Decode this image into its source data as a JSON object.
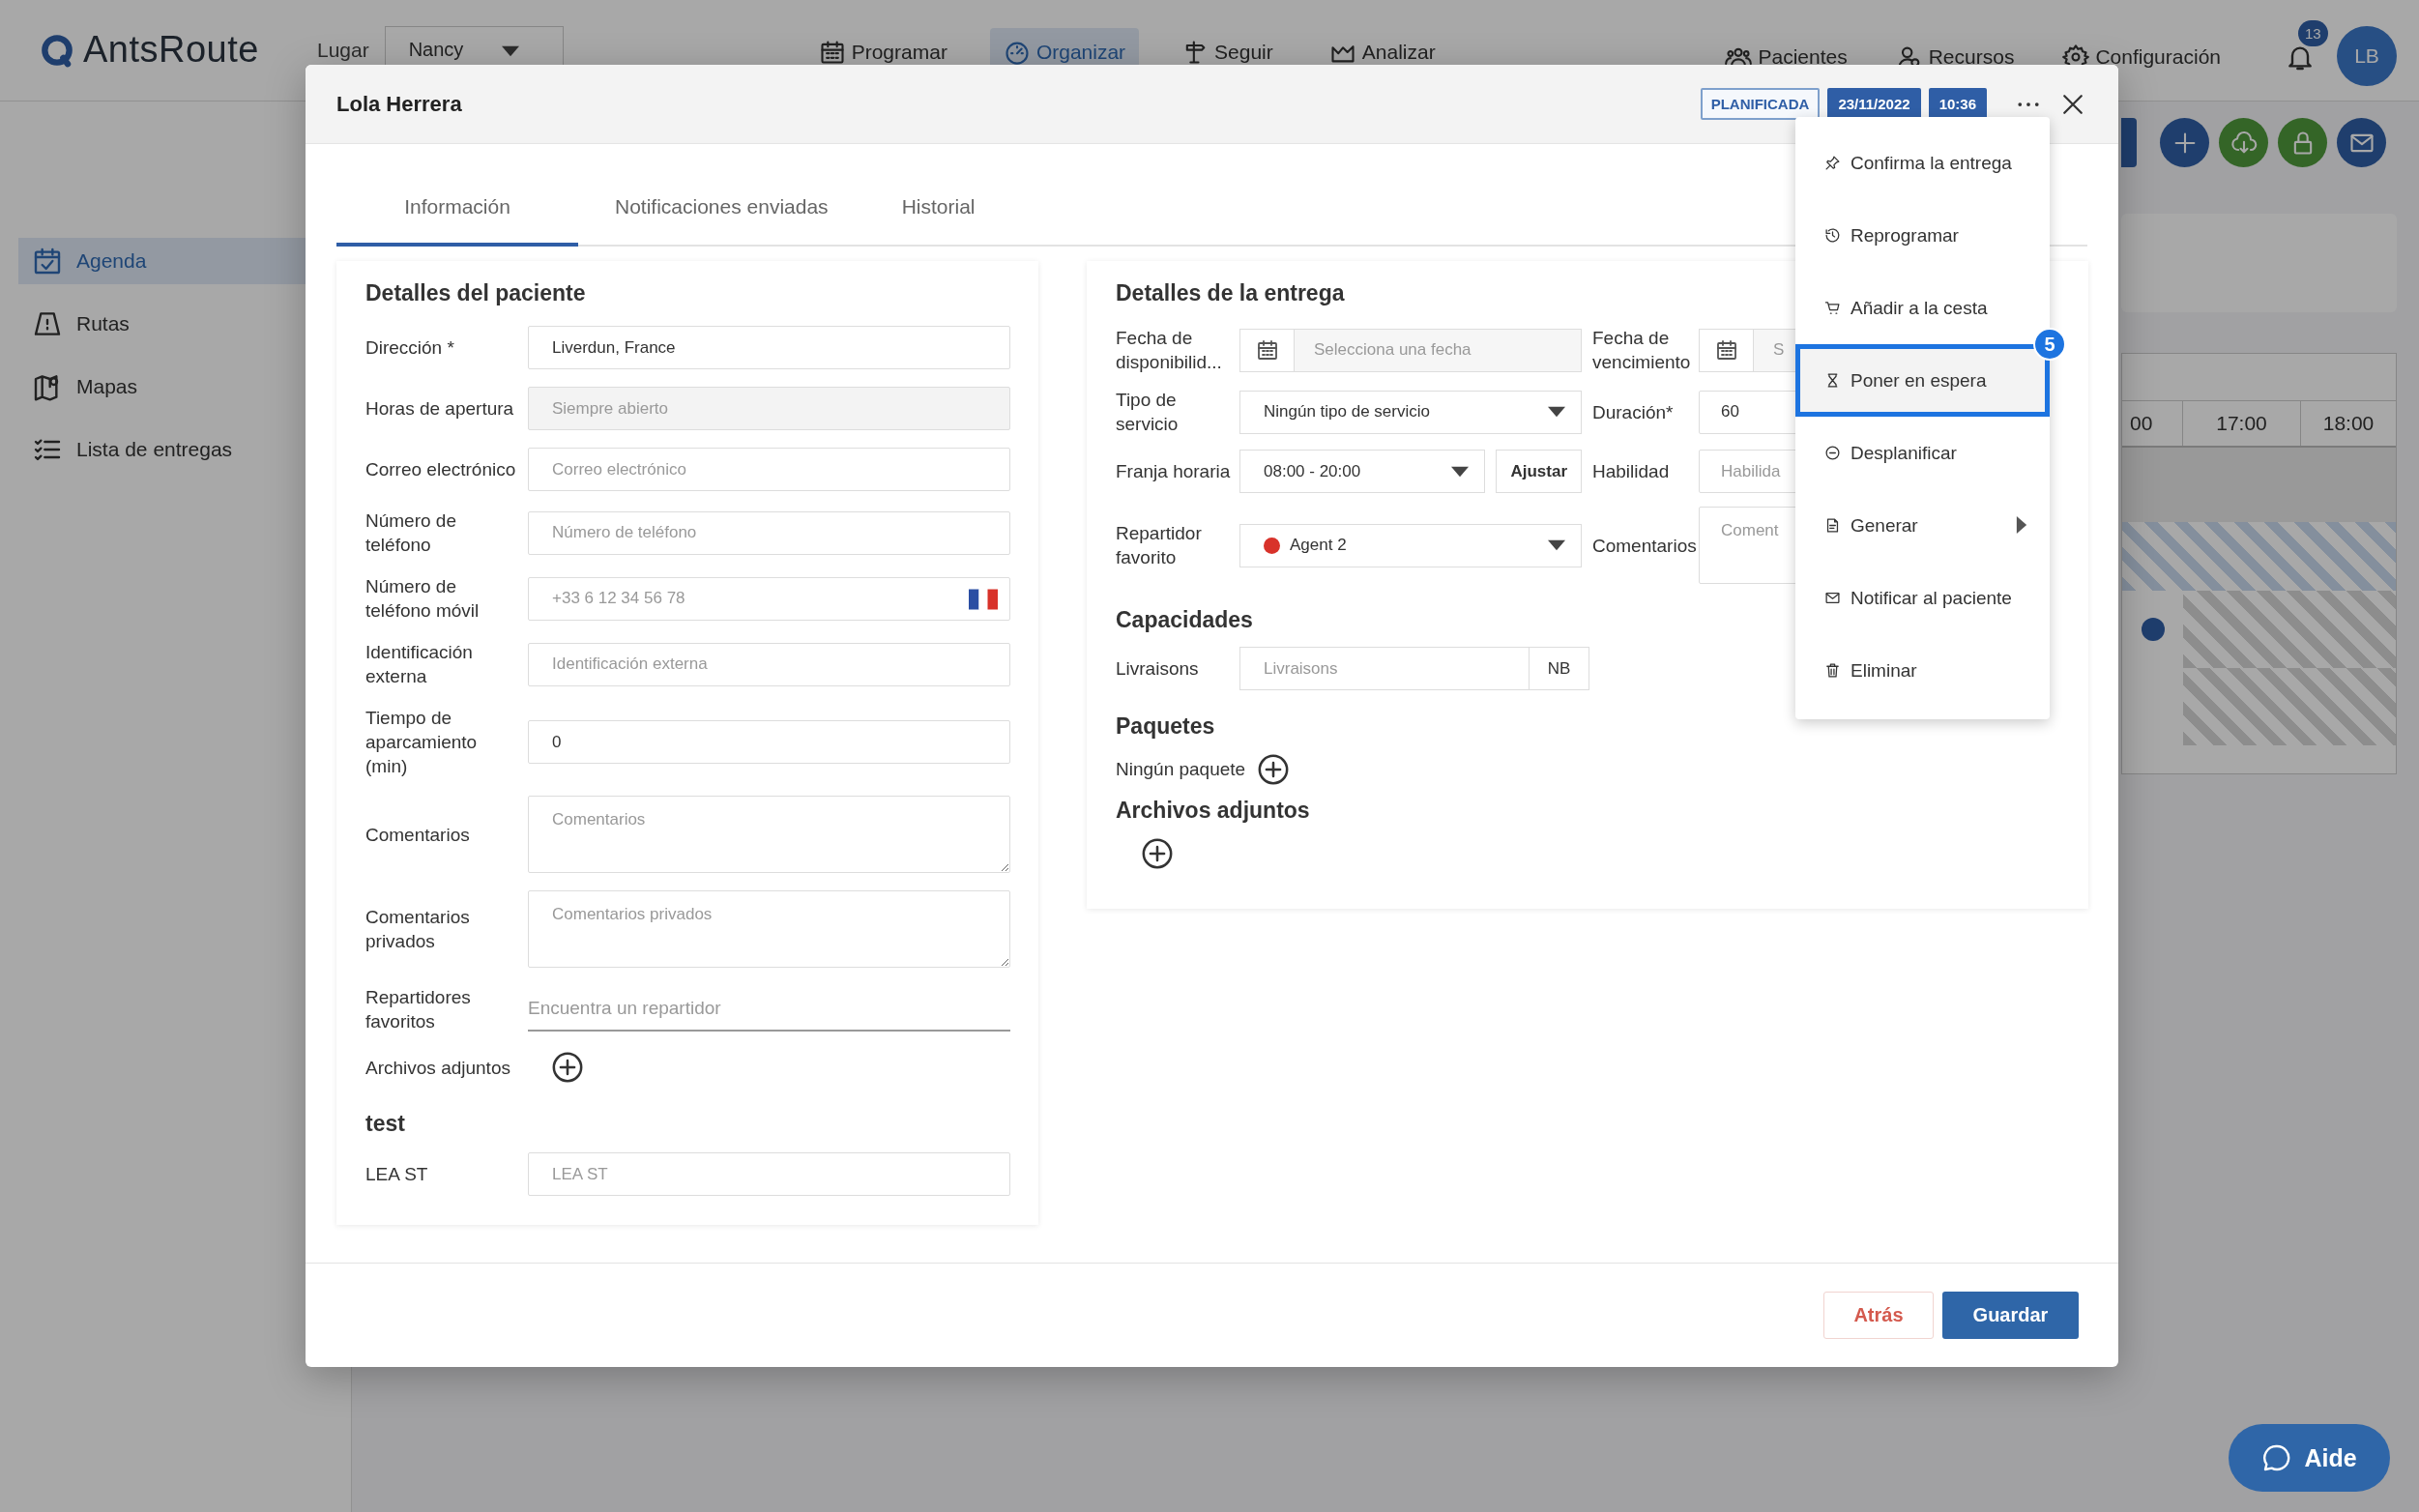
{
  "topbar": {
    "logo": "AntsRoute",
    "location_label": "Lugar",
    "location": "Nancy",
    "nav": [
      {
        "label": "Programar",
        "selected": false
      },
      {
        "label": "Organizar",
        "selected": true
      },
      {
        "label": "Seguir",
        "selected": false
      },
      {
        "label": "Analizar",
        "selected": false
      }
    ],
    "shortcuts": [
      "Pacientes",
      "Recursos",
      "Configuración"
    ],
    "notifications": "13",
    "avatar": "LB"
  },
  "sidebar": {
    "items": [
      {
        "label": "Agenda",
        "selected": true
      },
      {
        "label": "Rutas",
        "selected": false
      },
      {
        "label": "Mapas",
        "selected": false
      },
      {
        "label": "Lista de entregas",
        "selected": false
      }
    ]
  },
  "planner": {
    "timeline": {
      "columns": [
        "00",
        "17:00",
        "18:00"
      ]
    }
  },
  "modal": {
    "title": "Lola Herrera",
    "status": "PLANIFICADA",
    "date": "23/11/2022",
    "time": "10:36",
    "tabs": [
      {
        "label": "Información",
        "selected": true
      },
      {
        "label": "Notificaciones enviadas",
        "selected": false
      },
      {
        "label": "Historial",
        "selected": false
      }
    ],
    "patient": {
      "title": "Detalles del paciente",
      "fields": [
        {
          "label": "Dirección *",
          "kind": "input",
          "value": "Liverdun, France"
        },
        {
          "label": "Horas de apertura",
          "kind": "input",
          "placeholder": "Siempre abierto",
          "disabled": true
        },
        {
          "label": "Correo electrónico",
          "kind": "input",
          "placeholder": "Correo electrónico"
        },
        {
          "label": "Número de teléfono",
          "kind": "input",
          "placeholder": "Número de teléfono"
        },
        {
          "label": "Número de teléfono móvil",
          "kind": "phone",
          "placeholder": "+33 6 12 34 56 78"
        },
        {
          "label": "Identificación externa",
          "kind": "input",
          "placeholder": "Identificación externa"
        },
        {
          "label": "Tiempo de aparcamiento (min)",
          "kind": "input",
          "value": "0"
        },
        {
          "label": "Comentarios",
          "kind": "textarea",
          "placeholder": "Comentarios"
        },
        {
          "label": "Comentarios privados",
          "kind": "textarea",
          "placeholder": "Comentarios privados"
        },
        {
          "label": "Repartidores favoritos",
          "kind": "search",
          "placeholder": "Encuentra un repartidor"
        },
        {
          "label": "Archivos adjuntos",
          "kind": "attach"
        }
      ],
      "custom_title": "test",
      "custom_fields": [
        {
          "label": "LEA ST",
          "kind": "input",
          "placeholder": "LEA ST"
        }
      ]
    },
    "delivery": {
      "title": "Detalles de la entrega",
      "rows": [
        {
          "left": {
            "label": "Fecha de disponibilid...",
            "kind": "date",
            "placeholder": "Selecciona una fecha"
          },
          "right": {
            "label": "Fecha de vencimiento",
            "kind": "date",
            "placeholder": "S"
          }
        },
        {
          "left": {
            "label": "Tipo de servicio",
            "kind": "select",
            "value": "Ningún tipo de servicio"
          },
          "right": {
            "label": "Duración*",
            "kind": "input",
            "value": "60"
          }
        },
        {
          "left": {
            "label": "Franja horaria",
            "kind": "select",
            "value": "08:00 - 20:00",
            "button": "Ajustar"
          },
          "right": {
            "label": "Habilidad",
            "kind": "input",
            "placeholder": "Habilida"
          }
        },
        {
          "left": {
            "label": "Repartidor favorito",
            "kind": "select",
            "value": "Agent 2",
            "color": "#d8322a"
          },
          "right": {
            "label": "Comentarios",
            "kind": "textarea",
            "placeholder": "Coment"
          }
        }
      ],
      "capacities": {
        "title": "Capacidades",
        "items": [
          {
            "label": "Livraisons",
            "placeholder": "Livraisons",
            "unit": "NB"
          }
        ]
      },
      "packages": {
        "title": "Paquetes",
        "empty": "Ningún paquete"
      },
      "attachments": {
        "title": "Archivos adjuntos"
      }
    },
    "menu": {
      "items": [
        {
          "label": "Confirma la entrega",
          "selected": false,
          "submenu": false
        },
        {
          "label": "Reprogramar",
          "selected": false,
          "submenu": false
        },
        {
          "label": "Añadir a la cesta",
          "selected": false,
          "submenu": false
        },
        {
          "label": "Poner en espera",
          "selected": true,
          "submenu": false,
          "badge": "5"
        },
        {
          "label": "Desplanificar",
          "selected": false,
          "submenu": false
        },
        {
          "label": "Generar",
          "selected": false,
          "submenu": true
        },
        {
          "label": "Notificar al paciente",
          "selected": false,
          "submenu": false
        },
        {
          "label": "Eliminar",
          "selected": false,
          "submenu": false
        }
      ]
    },
    "buttons": [
      {
        "label": "Atrás",
        "kind": "secondary"
      },
      {
        "label": "Guardar",
        "kind": "primary"
      }
    ]
  },
  "help_button": "Aide"
}
